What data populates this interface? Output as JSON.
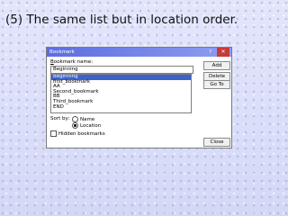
{
  "slide": {
    "title": "(5) The same list but in location order."
  },
  "dialog": {
    "title": "Bookmark",
    "help": "?",
    "close_glyph": "✕",
    "name_label": "Bookmark name:",
    "name_value": "Beginning",
    "bookmarks": [
      "Beginning",
      "first_bookmark",
      "AA",
      "Second_bookmark",
      "BB",
      "Third_bookmark",
      "END"
    ],
    "selected_index": 0,
    "buttons": {
      "add": "Add",
      "delete": "Delete",
      "goto": "Go To",
      "close": "Close"
    },
    "sort_label": "Sort by:",
    "sort_options": [
      "Name",
      "Location"
    ],
    "sort_selected": "Location",
    "hidden_bookmarks_label": "Hidden bookmarks",
    "hidden_bookmarks_checked": false
  }
}
